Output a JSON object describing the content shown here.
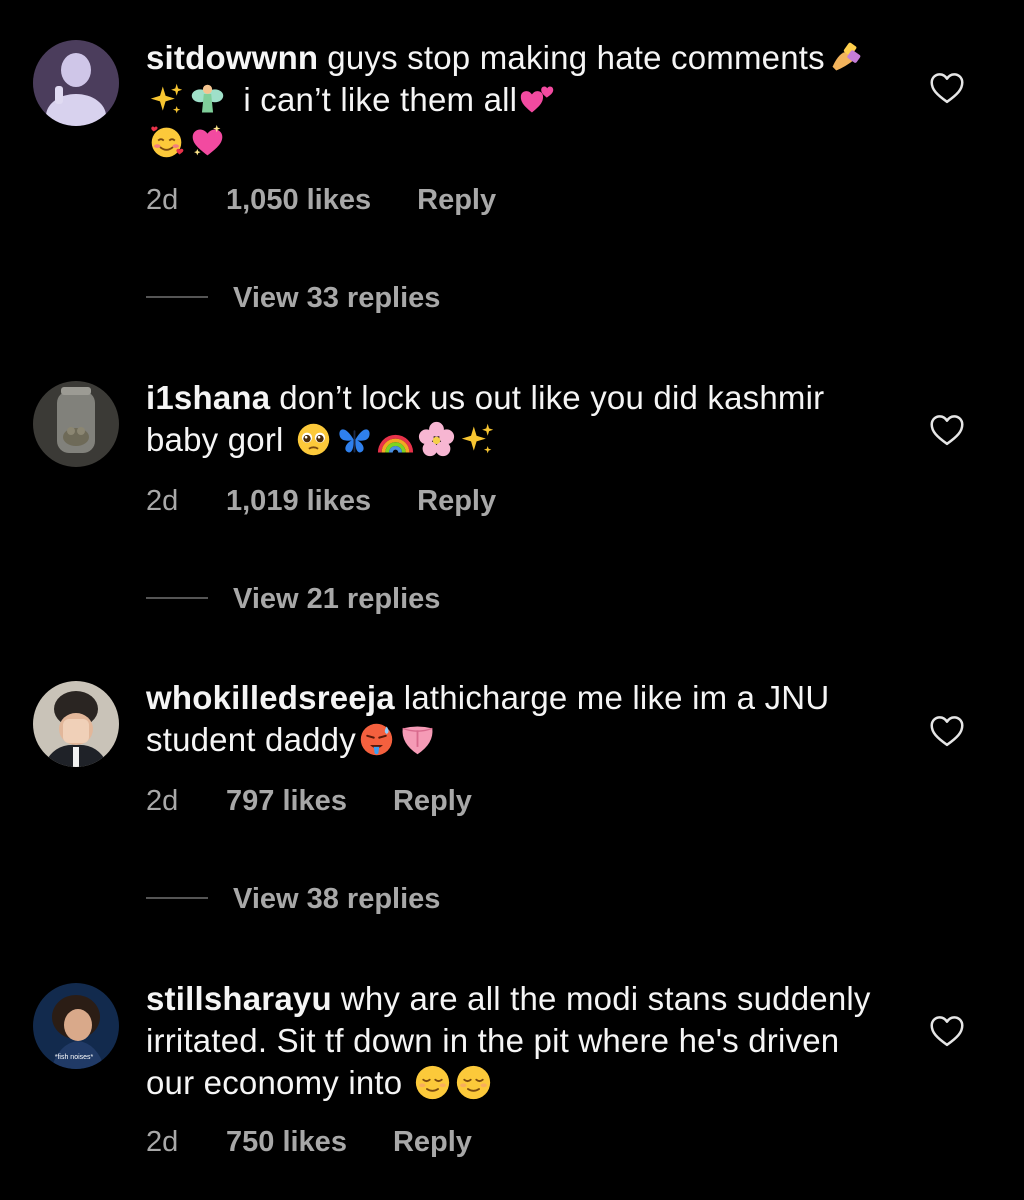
{
  "comments": [
    {
      "username": "sitdowwnn",
      "text_1": "guys stop making hate comments",
      "emoji_1": [
        "nail-polish-emoji",
        "sparkles-emoji",
        "fairy-emoji"
      ],
      "text_2": "i can’t like them all",
      "emoji_2": [
        "two-hearts-emoji",
        "smiling-face-with-hearts-emoji",
        "sparkling-heart-emoji"
      ],
      "age": "2d",
      "likes": "1,050 likes",
      "reply": "Reply",
      "view_replies": "View 33 replies"
    },
    {
      "username": "i1shana",
      "text_1": "don’t lock us out like you did kashmir baby gorl",
      "emoji_1": [
        "pleading-face-emoji",
        "butterfly-emoji",
        "rainbow-emoji",
        "cherry-blossom-emoji",
        "sparkles-emoji"
      ],
      "age": "2d",
      "likes": "1,019 likes",
      "reply": "Reply",
      "view_replies": "View 21 replies"
    },
    {
      "username": "whokilledsreeja",
      "text_1": "lathicharge me like im a JNU student daddy",
      "emoji_1": [
        "hot-face-emoji",
        "tongue-emoji"
      ],
      "age": "2d",
      "likes": "797 likes",
      "reply": "Reply",
      "view_replies": "View 38 replies"
    },
    {
      "username": "stillsharayu",
      "text_1": "why are all the modi stans suddenly irritated. Sit tf down in the pit where he's driven our economy into",
      "emoji_1": [
        "relieved-face-emoji",
        "relieved-face-emoji"
      ],
      "age": "2d",
      "likes": "750 likes",
      "reply": "Reply"
    }
  ],
  "avatar_caption": "*fish noises*",
  "icons": {
    "like": "heart-outline-icon"
  },
  "colors": {
    "background": "#000000",
    "text": "#f5f5f5",
    "secondary": "#a8a8a8"
  }
}
